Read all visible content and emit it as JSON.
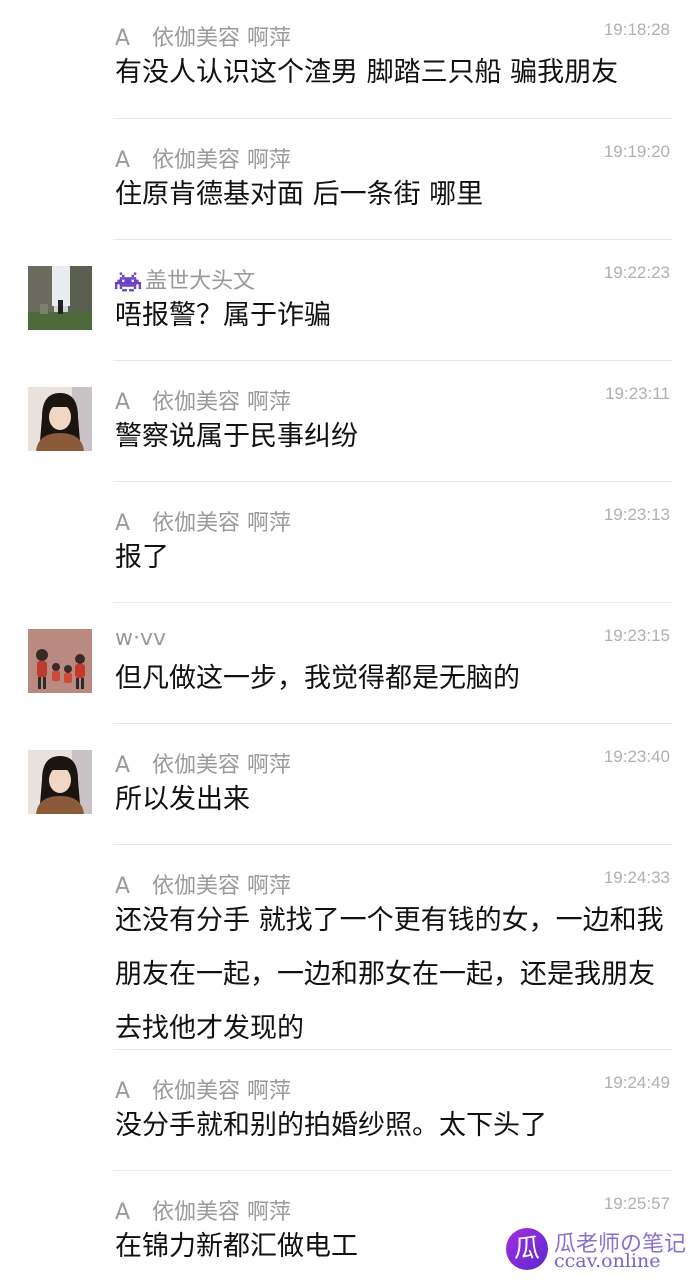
{
  "messages": [
    {
      "name": "A　依伽美容 啊萍",
      "time": "19:18:28",
      "text": "有没人认识这个渣男 脚踏三只船 骗我朋友",
      "avatar": "none"
    },
    {
      "name": "A　依伽美容 啊萍",
      "time": "19:19:20",
      "text": "住原肯德基对面 后一条街 哪里",
      "avatar": "none"
    },
    {
      "name": "盖世大头文",
      "name_icon": "space-invader-icon",
      "time": "19:22:23",
      "text": "唔报警？属于诈骗",
      "avatar": "landscape-photo"
    },
    {
      "name": "A　依伽美容 啊萍",
      "time": "19:23:11",
      "text": "警察说属于民事纠纷",
      "avatar": "woman-portrait"
    },
    {
      "name": "A　依伽美容 啊萍",
      "time": "19:23:13",
      "text": "报了",
      "avatar": "none"
    },
    {
      "name": "w·vv",
      "time": "19:23:15",
      "text": "但凡做这一步，我觉得都是无脑的",
      "avatar": "family-cartoon"
    },
    {
      "name": "A　依伽美容 啊萍",
      "time": "19:23:40",
      "text": "所以发出来",
      "avatar": "woman-portrait"
    },
    {
      "name": "A　依伽美容 啊萍",
      "time": "19:24:33",
      "text": "还没有分手 就找了一个更有钱的女，一边和我朋友在一起，一边和那女在一起，还是我朋友去找他才发现的",
      "avatar": "none"
    },
    {
      "name": "A　依伽美容 啊萍",
      "time": "19:24:49",
      "text": "没分手就和别的拍婚纱照。太下头了",
      "avatar": "none"
    },
    {
      "name": "A　依伽美容 啊萍",
      "time": "19:25:57",
      "text": "在锦力新都汇做电工",
      "avatar": "none"
    }
  ],
  "watermark": {
    "logo_glyph": "瓜",
    "title": "瓜老师の笔记",
    "url": "ccav.online"
  }
}
